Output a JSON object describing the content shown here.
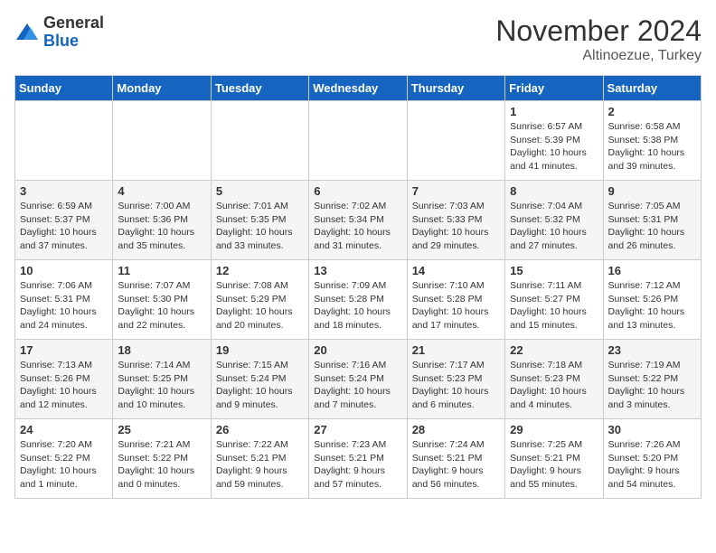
{
  "header": {
    "logo": {
      "general": "General",
      "blue": "Blue"
    },
    "title": "November 2024",
    "location": "Altinoezue, Turkey"
  },
  "weekdays": [
    "Sunday",
    "Monday",
    "Tuesday",
    "Wednesday",
    "Thursday",
    "Friday",
    "Saturday"
  ],
  "weeks": [
    [
      {
        "day": "",
        "info": ""
      },
      {
        "day": "",
        "info": ""
      },
      {
        "day": "",
        "info": ""
      },
      {
        "day": "",
        "info": ""
      },
      {
        "day": "",
        "info": ""
      },
      {
        "day": "1",
        "info": "Sunrise: 6:57 AM\nSunset: 5:39 PM\nDaylight: 10 hours and 41 minutes."
      },
      {
        "day": "2",
        "info": "Sunrise: 6:58 AM\nSunset: 5:38 PM\nDaylight: 10 hours and 39 minutes."
      }
    ],
    [
      {
        "day": "3",
        "info": "Sunrise: 6:59 AM\nSunset: 5:37 PM\nDaylight: 10 hours and 37 minutes."
      },
      {
        "day": "4",
        "info": "Sunrise: 7:00 AM\nSunset: 5:36 PM\nDaylight: 10 hours and 35 minutes."
      },
      {
        "day": "5",
        "info": "Sunrise: 7:01 AM\nSunset: 5:35 PM\nDaylight: 10 hours and 33 minutes."
      },
      {
        "day": "6",
        "info": "Sunrise: 7:02 AM\nSunset: 5:34 PM\nDaylight: 10 hours and 31 minutes."
      },
      {
        "day": "7",
        "info": "Sunrise: 7:03 AM\nSunset: 5:33 PM\nDaylight: 10 hours and 29 minutes."
      },
      {
        "day": "8",
        "info": "Sunrise: 7:04 AM\nSunset: 5:32 PM\nDaylight: 10 hours and 27 minutes."
      },
      {
        "day": "9",
        "info": "Sunrise: 7:05 AM\nSunset: 5:31 PM\nDaylight: 10 hours and 26 minutes."
      }
    ],
    [
      {
        "day": "10",
        "info": "Sunrise: 7:06 AM\nSunset: 5:31 PM\nDaylight: 10 hours and 24 minutes."
      },
      {
        "day": "11",
        "info": "Sunrise: 7:07 AM\nSunset: 5:30 PM\nDaylight: 10 hours and 22 minutes."
      },
      {
        "day": "12",
        "info": "Sunrise: 7:08 AM\nSunset: 5:29 PM\nDaylight: 10 hours and 20 minutes."
      },
      {
        "day": "13",
        "info": "Sunrise: 7:09 AM\nSunset: 5:28 PM\nDaylight: 10 hours and 18 minutes."
      },
      {
        "day": "14",
        "info": "Sunrise: 7:10 AM\nSunset: 5:28 PM\nDaylight: 10 hours and 17 minutes."
      },
      {
        "day": "15",
        "info": "Sunrise: 7:11 AM\nSunset: 5:27 PM\nDaylight: 10 hours and 15 minutes."
      },
      {
        "day": "16",
        "info": "Sunrise: 7:12 AM\nSunset: 5:26 PM\nDaylight: 10 hours and 13 minutes."
      }
    ],
    [
      {
        "day": "17",
        "info": "Sunrise: 7:13 AM\nSunset: 5:26 PM\nDaylight: 10 hours and 12 minutes."
      },
      {
        "day": "18",
        "info": "Sunrise: 7:14 AM\nSunset: 5:25 PM\nDaylight: 10 hours and 10 minutes."
      },
      {
        "day": "19",
        "info": "Sunrise: 7:15 AM\nSunset: 5:24 PM\nDaylight: 10 hours and 9 minutes."
      },
      {
        "day": "20",
        "info": "Sunrise: 7:16 AM\nSunset: 5:24 PM\nDaylight: 10 hours and 7 minutes."
      },
      {
        "day": "21",
        "info": "Sunrise: 7:17 AM\nSunset: 5:23 PM\nDaylight: 10 hours and 6 minutes."
      },
      {
        "day": "22",
        "info": "Sunrise: 7:18 AM\nSunset: 5:23 PM\nDaylight: 10 hours and 4 minutes."
      },
      {
        "day": "23",
        "info": "Sunrise: 7:19 AM\nSunset: 5:22 PM\nDaylight: 10 hours and 3 minutes."
      }
    ],
    [
      {
        "day": "24",
        "info": "Sunrise: 7:20 AM\nSunset: 5:22 PM\nDaylight: 10 hours and 1 minute."
      },
      {
        "day": "25",
        "info": "Sunrise: 7:21 AM\nSunset: 5:22 PM\nDaylight: 10 hours and 0 minutes."
      },
      {
        "day": "26",
        "info": "Sunrise: 7:22 AM\nSunset: 5:21 PM\nDaylight: 9 hours and 59 minutes."
      },
      {
        "day": "27",
        "info": "Sunrise: 7:23 AM\nSunset: 5:21 PM\nDaylight: 9 hours and 57 minutes."
      },
      {
        "day": "28",
        "info": "Sunrise: 7:24 AM\nSunset: 5:21 PM\nDaylight: 9 hours and 56 minutes."
      },
      {
        "day": "29",
        "info": "Sunrise: 7:25 AM\nSunset: 5:21 PM\nDaylight: 9 hours and 55 minutes."
      },
      {
        "day": "30",
        "info": "Sunrise: 7:26 AM\nSunset: 5:20 PM\nDaylight: 9 hours and 54 minutes."
      }
    ]
  ]
}
